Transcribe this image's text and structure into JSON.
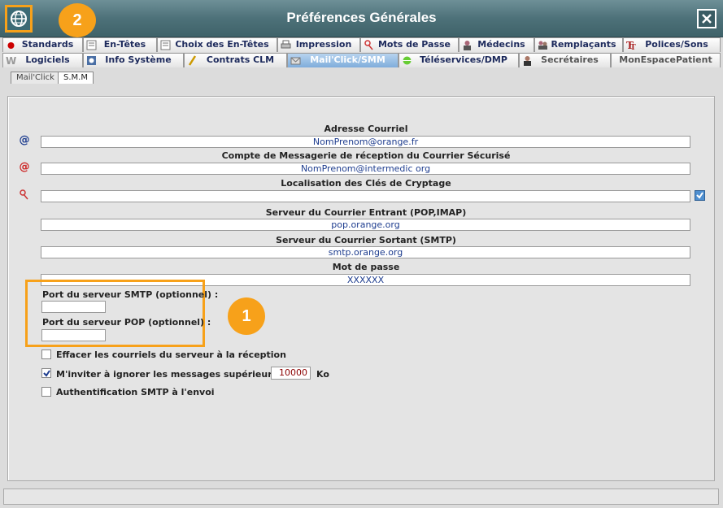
{
  "window": {
    "title": "Préférences Générales"
  },
  "callouts": {
    "one": "1",
    "two": "2"
  },
  "tabs_row1": [
    {
      "label": "Standards",
      "icon": "red-dot-icon"
    },
    {
      "label": "En-Têtes",
      "icon": "header-doc-icon"
    },
    {
      "label": "Choix des En-Têtes",
      "icon": "header-choice-icon"
    },
    {
      "label": "Impression",
      "icon": "printer-icon"
    },
    {
      "label": "Mots de Passe",
      "icon": "key-icon"
    },
    {
      "label": "Médecins",
      "icon": "doctor-icon"
    },
    {
      "label": "Remplaçants",
      "icon": "replacement-icon"
    },
    {
      "label": "Polices/Sons",
      "icon": "font-icon"
    }
  ],
  "tabs_row2": [
    {
      "label": "Logiciels",
      "icon": "w-icon"
    },
    {
      "label": "Info Système",
      "icon": "system-icon"
    },
    {
      "label": "Contrats CLM",
      "icon": "pencil-icon"
    },
    {
      "label": "Mail'Click/SMM",
      "icon": "mail-icon",
      "active": true
    },
    {
      "label": "Téléservices/DMP",
      "icon": "globe-icon"
    },
    {
      "label": "Secrétaires",
      "icon": "secretary-icon"
    },
    {
      "label": "MonEspacePatient",
      "icon": ""
    }
  ],
  "subtabs": [
    "Mail'Click",
    "S.M.M"
  ],
  "form": {
    "email_label": "Adresse Courriel",
    "email_value": "NomPrenom@orange.fr",
    "secure_label": "Compte de Messagerie de réception du Courrier Sécurisé",
    "secure_value": "NomPrenom@intermedic org",
    "keys_label": "Localisation des Clés de Cryptage",
    "keys_value": "",
    "incoming_label": "Serveur du Courrier Entrant (POP,IMAP)",
    "incoming_value": "pop.orange.org",
    "outgoing_label": "Serveur du Courrier Sortant (SMTP)",
    "outgoing_value": "smtp.orange.org",
    "password_label": "Mot de passe",
    "password_value": "XXXXXX",
    "smtp_port_label": "Port du serveur SMTP (optionnel) :",
    "smtp_port_value": "",
    "pop_port_label": "Port du serveur POP (optionnel) :",
    "pop_port_value": "",
    "delete_label": "Effacer les courriels du serveur à la réception",
    "delete_checked": false,
    "ignore_label": "M'inviter à ignorer les messages supérieurs à :",
    "ignore_checked": true,
    "ignore_value": "10000",
    "ignore_unit": "Ko",
    "auth_label": "Authentification SMTP à l'envoi",
    "auth_checked": false
  },
  "colors": {
    "accent": "#f7a11a",
    "titlebar": "#4d7179",
    "field_text": "#1e3d8f",
    "active_tab": "#7faddb"
  }
}
